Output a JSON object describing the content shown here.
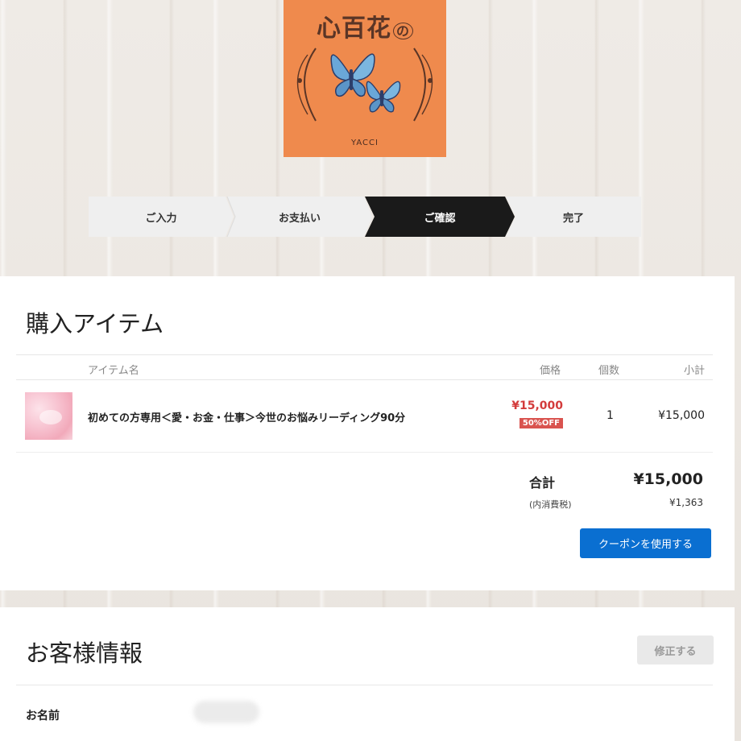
{
  "logo": {
    "title": "心百花",
    "title_suffix": "の",
    "subtitle": "YACCI",
    "background_color": "#ef8a4d"
  },
  "steps": [
    {
      "label": "ご入力",
      "active": false
    },
    {
      "label": "お支払い",
      "active": false
    },
    {
      "label": "ご確認",
      "active": true
    },
    {
      "label": "完了",
      "active": false
    }
  ],
  "purchase": {
    "section_title": "購入アイテム",
    "columns": {
      "item_name": "アイテム名",
      "price": "価格",
      "quantity": "個数",
      "subtotal": "小計"
    },
    "items": [
      {
        "thumbnail": "pink-flower-image",
        "name": "初めての方専用＜愛・お金・仕事＞今世のお悩みリーディング90分",
        "price": "¥15,000",
        "discount_badge": "50%OFF",
        "quantity": "1",
        "subtotal": "¥15,000"
      }
    ],
    "total_label": "合計",
    "total_value": "¥15,000",
    "tax_label": "(内消費税)",
    "tax_value": "¥1,363",
    "coupon_button": "クーポンを使用する"
  },
  "customer": {
    "section_title": "お客様情報",
    "edit_button": "修正する",
    "name_label": "お名前"
  },
  "colors": {
    "accent_blue": "#0a6fd1",
    "price_red": "#d33b3b",
    "active_step": "#1a1a1a"
  }
}
